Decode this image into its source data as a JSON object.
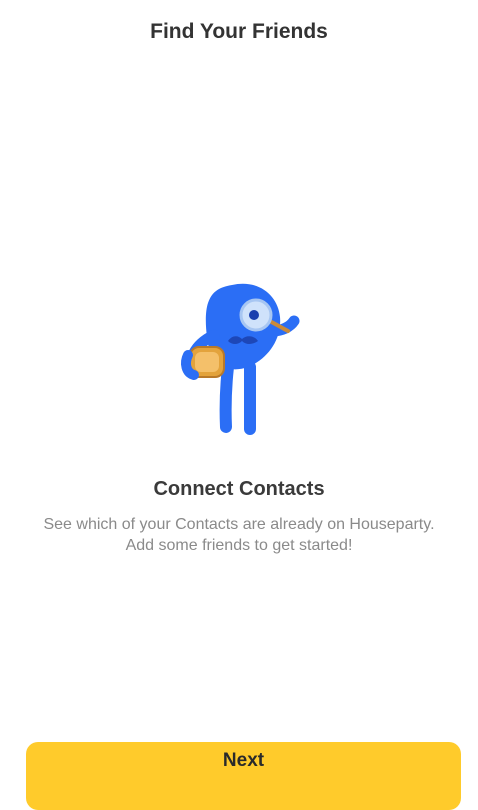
{
  "header": {
    "title": "Find Your Friends"
  },
  "illustration": {
    "icon": "houseparty-mascot-with-magnifier-and-toast",
    "colors": {
      "body": "#2b6ef5",
      "toast": "#e3a33c",
      "magnifier_glass": "#cfe2fb"
    }
  },
  "main": {
    "title": "Connect Contacts",
    "description": "See which of your Contacts are already on Houseparty. Add some friends to get started!"
  },
  "footer": {
    "next_label": "Next",
    "button_color": "#ffcb2b"
  }
}
